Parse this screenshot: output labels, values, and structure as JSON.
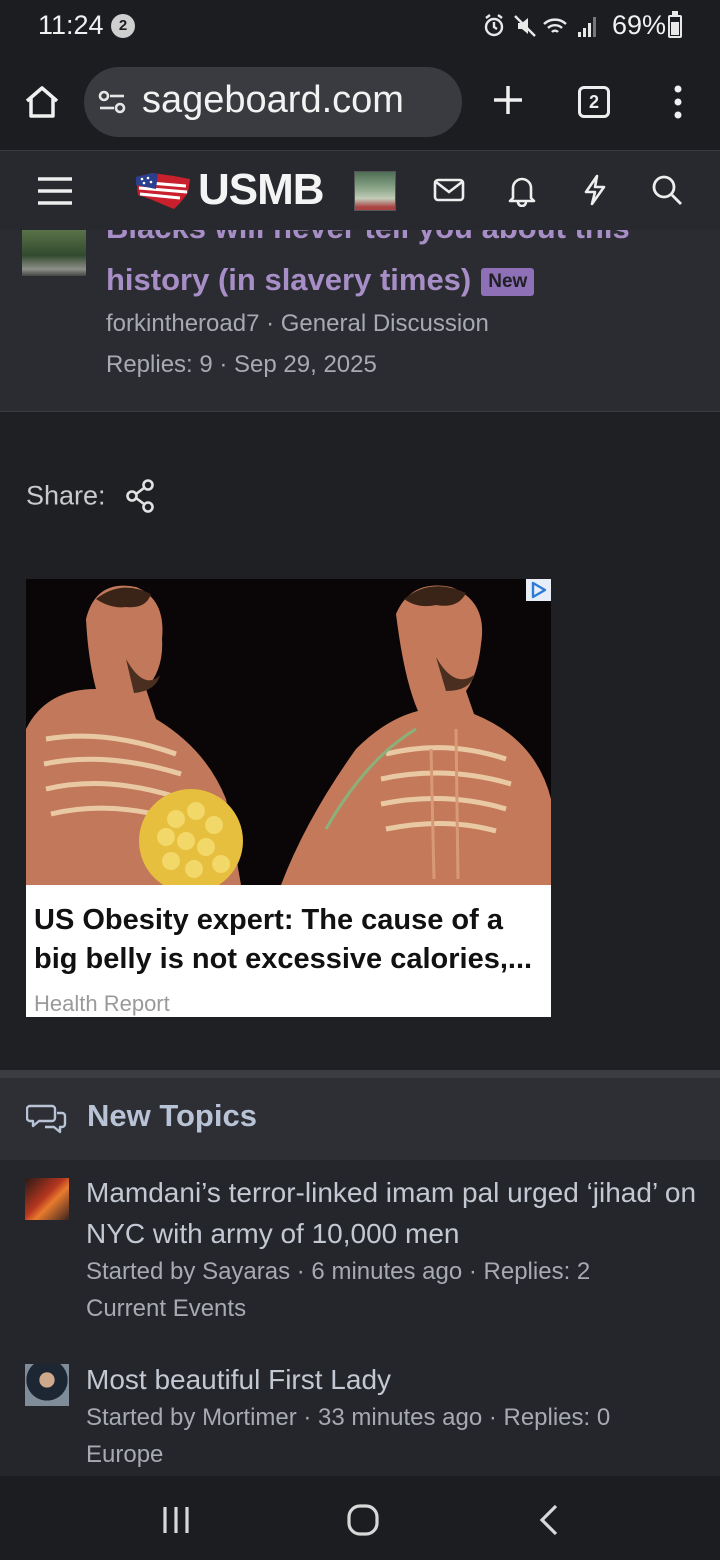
{
  "status_bar": {
    "time": "11:24",
    "notification_count": "2",
    "battery": "69%"
  },
  "browser": {
    "url": "sageboard.com",
    "tab_count": "2"
  },
  "site": {
    "logo": "USMB"
  },
  "previous_thread": {
    "title_cut": "Blacks will never tell you about this",
    "title": "history (in slavery times)",
    "badge": "New",
    "author": "forkintheroad7",
    "forum": "General Discussion",
    "meta_line": "forkintheroad7 · General Discussion",
    "stats_line": "Replies: 9 · Sep 29, 2025"
  },
  "share": {
    "label": "Share:"
  },
  "ad": {
    "headline": "US Obesity expert: The cause of a big belly is not excessive calories,...",
    "source": "Health Report"
  },
  "new_topics": {
    "heading": "New Topics",
    "items": [
      {
        "title": "Mamdani’s terror-linked imam pal urged ‘jihad’ on NYC with army of 10,000 men",
        "meta": "Started by Sayaras · 6 minutes ago · Replies: 2",
        "forum": "Current Events"
      },
      {
        "title": "Most beautiful First Lady",
        "meta": "Started by Mortimer · 33 minutes ago · Replies: 0",
        "forum": "Europe"
      }
    ]
  },
  "colors": {
    "link_purple": "#a88ec7",
    "badge_purple": "#8d70b5",
    "section_title": "#b9c3d6"
  },
  "icons": [
    "home-icon",
    "site-settings-icon",
    "plus-icon",
    "tabs-icon",
    "more-vert-icon",
    "menu-icon",
    "usa-flag-logo-icon",
    "mail-icon",
    "bell-icon",
    "lightning-icon",
    "search-icon",
    "share-icon",
    "ad-choices-icon",
    "chat-bubbles-icon",
    "recent-apps-icon",
    "home-circle-icon",
    "back-chevron-icon"
  ]
}
